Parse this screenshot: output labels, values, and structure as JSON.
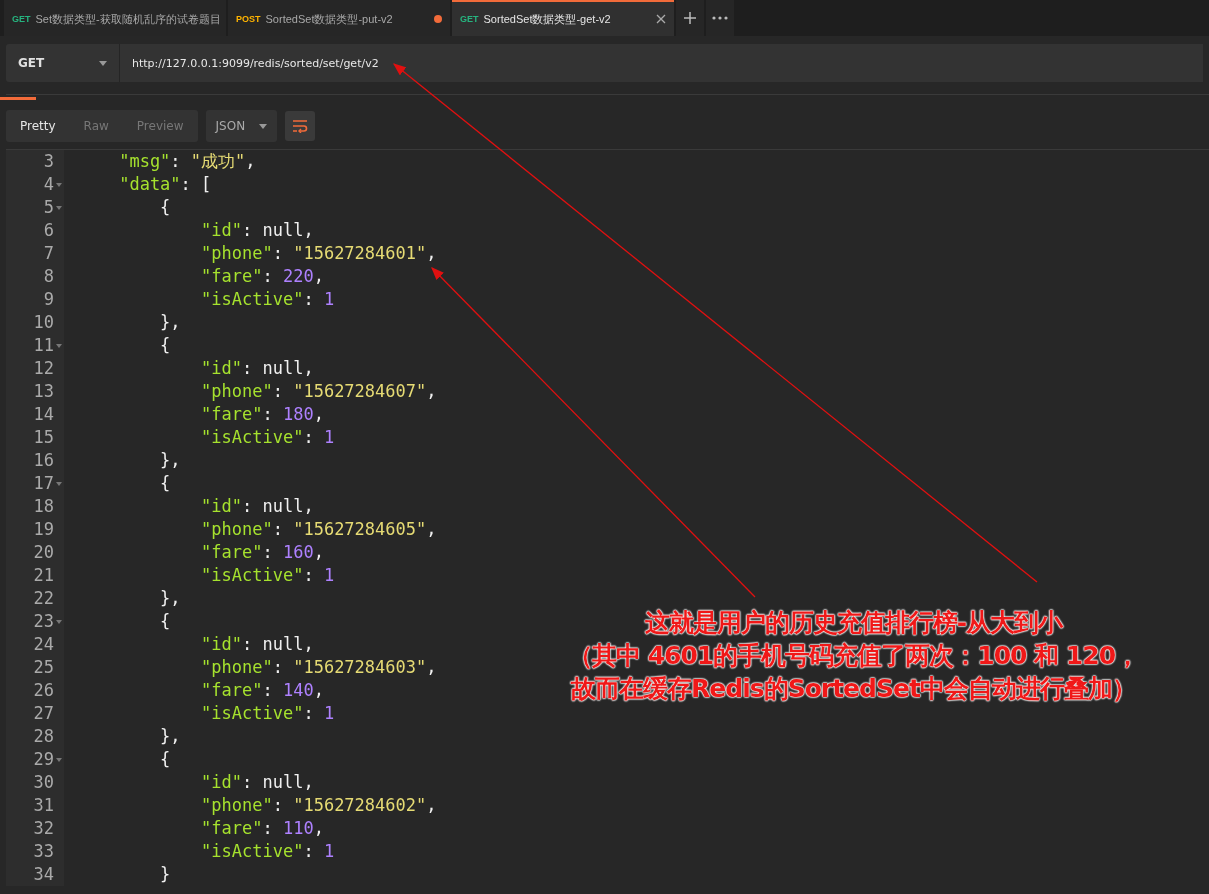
{
  "tabs": [
    {
      "method": "GET",
      "title": "Set数据类型-获取随机乱序的试卷题目",
      "selected": false,
      "unsaved": false
    },
    {
      "method": "POST",
      "title": "SortedSet数据类型-put-v2",
      "selected": false,
      "unsaved": true
    },
    {
      "method": "GET",
      "title": "SortedSet数据类型-get-v2",
      "selected": true,
      "unsaved": false
    }
  ],
  "request": {
    "method": "GET",
    "url": "http://127.0.0.1:9099/redis/sorted/set/get/v2"
  },
  "response_tab_indicator": {
    "level": 0.03
  },
  "view_modes": [
    {
      "label": "Pretty",
      "selected": true
    },
    {
      "label": "Raw",
      "selected": false
    },
    {
      "label": "Preview",
      "selected": false
    }
  ],
  "format": "JSON",
  "code_lines": [
    {
      "number": "3",
      "foldable": false,
      "tokens": [
        {
          "kind": "key",
          "text": "\"msg\""
        },
        {
          "kind": "punct",
          "text": ": "
        },
        {
          "kind": "string",
          "text": "\"成功\""
        },
        {
          "kind": "punct",
          "text": ","
        }
      ]
    },
    {
      "number": "4",
      "foldable": true,
      "tokens": [
        {
          "kind": "key",
          "text": "\"data\""
        },
        {
          "kind": "punct",
          "text": ": ["
        }
      ]
    },
    {
      "number": "5",
      "foldable": true,
      "tokens": [
        {
          "kind": "punct",
          "text": "{"
        }
      ]
    },
    {
      "number": "6",
      "foldable": false,
      "tokens": [
        {
          "kind": "key",
          "text": "\"id\""
        },
        {
          "kind": "punct",
          "text": ": null,"
        }
      ]
    },
    {
      "number": "7",
      "foldable": false,
      "tokens": [
        {
          "kind": "key",
          "text": "\"phone\""
        },
        {
          "kind": "punct",
          "text": ": "
        },
        {
          "kind": "string",
          "text": "\"15627284601\""
        },
        {
          "kind": "punct",
          "text": ","
        }
      ]
    },
    {
      "number": "8",
      "foldable": false,
      "tokens": [
        {
          "kind": "key",
          "text": "\"fare\""
        },
        {
          "kind": "punct",
          "text": ": "
        },
        {
          "kind": "number",
          "text": "220"
        },
        {
          "kind": "punct",
          "text": ","
        }
      ]
    },
    {
      "number": "9",
      "foldable": false,
      "tokens": [
        {
          "kind": "key",
          "text": "\"isActive\""
        },
        {
          "kind": "punct",
          "text": ": "
        },
        {
          "kind": "number",
          "text": "1"
        }
      ]
    },
    {
      "number": "10",
      "foldable": false,
      "tokens": [
        {
          "kind": "punct",
          "text": "},"
        }
      ]
    },
    {
      "number": "11",
      "foldable": true,
      "tokens": [
        {
          "kind": "punct",
          "text": "{"
        }
      ]
    },
    {
      "number": "12",
      "foldable": false,
      "tokens": [
        {
          "kind": "key",
          "text": "\"id\""
        },
        {
          "kind": "punct",
          "text": ": null,"
        }
      ]
    },
    {
      "number": "13",
      "foldable": false,
      "tokens": [
        {
          "kind": "key",
          "text": "\"phone\""
        },
        {
          "kind": "punct",
          "text": ": "
        },
        {
          "kind": "string",
          "text": "\"15627284607\""
        },
        {
          "kind": "punct",
          "text": ","
        }
      ]
    },
    {
      "number": "14",
      "foldable": false,
      "tokens": [
        {
          "kind": "key",
          "text": "\"fare\""
        },
        {
          "kind": "punct",
          "text": ": "
        },
        {
          "kind": "number",
          "text": "180"
        },
        {
          "kind": "punct",
          "text": ","
        }
      ]
    },
    {
      "number": "15",
      "foldable": false,
      "tokens": [
        {
          "kind": "key",
          "text": "\"isActive\""
        },
        {
          "kind": "punct",
          "text": ": "
        },
        {
          "kind": "number",
          "text": "1"
        }
      ]
    },
    {
      "number": "16",
      "foldable": false,
      "tokens": [
        {
          "kind": "punct",
          "text": "},"
        }
      ]
    },
    {
      "number": "17",
      "foldable": true,
      "tokens": [
        {
          "kind": "punct",
          "text": "{"
        }
      ]
    },
    {
      "number": "18",
      "foldable": false,
      "tokens": [
        {
          "kind": "key",
          "text": "\"id\""
        },
        {
          "kind": "punct",
          "text": ": null,"
        }
      ]
    },
    {
      "number": "19",
      "foldable": false,
      "tokens": [
        {
          "kind": "key",
          "text": "\"phone\""
        },
        {
          "kind": "punct",
          "text": ": "
        },
        {
          "kind": "string",
          "text": "\"15627284605\""
        },
        {
          "kind": "punct",
          "text": ","
        }
      ]
    },
    {
      "number": "20",
      "foldable": false,
      "tokens": [
        {
          "kind": "key",
          "text": "\"fare\""
        },
        {
          "kind": "punct",
          "text": ": "
        },
        {
          "kind": "number",
          "text": "160"
        },
        {
          "kind": "punct",
          "text": ","
        }
      ]
    },
    {
      "number": "21",
      "foldable": false,
      "tokens": [
        {
          "kind": "key",
          "text": "\"isActive\""
        },
        {
          "kind": "punct",
          "text": ": "
        },
        {
          "kind": "number",
          "text": "1"
        }
      ]
    },
    {
      "number": "22",
      "foldable": false,
      "tokens": [
        {
          "kind": "punct",
          "text": "},"
        }
      ]
    },
    {
      "number": "23",
      "foldable": true,
      "tokens": [
        {
          "kind": "punct",
          "text": "{"
        }
      ]
    },
    {
      "number": "24",
      "foldable": false,
      "tokens": [
        {
          "kind": "key",
          "text": "\"id\""
        },
        {
          "kind": "punct",
          "text": ": null,"
        }
      ]
    },
    {
      "number": "25",
      "foldable": false,
      "tokens": [
        {
          "kind": "key",
          "text": "\"phone\""
        },
        {
          "kind": "punct",
          "text": ": "
        },
        {
          "kind": "string",
          "text": "\"15627284603\""
        },
        {
          "kind": "punct",
          "text": ","
        }
      ]
    },
    {
      "number": "26",
      "foldable": false,
      "tokens": [
        {
          "kind": "key",
          "text": "\"fare\""
        },
        {
          "kind": "punct",
          "text": ": "
        },
        {
          "kind": "number",
          "text": "140"
        },
        {
          "kind": "punct",
          "text": ","
        }
      ]
    },
    {
      "number": "27",
      "foldable": false,
      "tokens": [
        {
          "kind": "key",
          "text": "\"isActive\""
        },
        {
          "kind": "punct",
          "text": ": "
        },
        {
          "kind": "number",
          "text": "1"
        }
      ]
    },
    {
      "number": "28",
      "foldable": false,
      "tokens": [
        {
          "kind": "punct",
          "text": "},"
        }
      ]
    },
    {
      "number": "29",
      "foldable": true,
      "tokens": [
        {
          "kind": "punct",
          "text": "{"
        }
      ]
    },
    {
      "number": "30",
      "foldable": false,
      "tokens": [
        {
          "kind": "key",
          "text": "\"id\""
        },
        {
          "kind": "punct",
          "text": ": null,"
        }
      ]
    },
    {
      "number": "31",
      "foldable": false,
      "tokens": [
        {
          "kind": "key",
          "text": "\"phone\""
        },
        {
          "kind": "punct",
          "text": ": "
        },
        {
          "kind": "string",
          "text": "\"15627284602\""
        },
        {
          "kind": "punct",
          "text": ","
        }
      ]
    },
    {
      "number": "32",
      "foldable": false,
      "tokens": [
        {
          "kind": "key",
          "text": "\"fare\""
        },
        {
          "kind": "punct",
          "text": ": "
        },
        {
          "kind": "number",
          "text": "110"
        },
        {
          "kind": "punct",
          "text": ","
        }
      ]
    },
    {
      "number": "33",
      "foldable": false,
      "tokens": [
        {
          "kind": "key",
          "text": "\"isActive\""
        },
        {
          "kind": "punct",
          "text": ": "
        },
        {
          "kind": "number",
          "text": "1"
        }
      ]
    },
    {
      "number": "34",
      "foldable": false,
      "tokens": [
        {
          "kind": "punct",
          "text": "}"
        }
      ]
    }
  ],
  "annotation": {
    "lines": [
      "这就是用户的历史充值排行榜-从大到小",
      "（其中  4601的手机号码充值了两次：100 和 120，",
      "故而在缓存Redis的SortedSet中会自动进行叠加）"
    ]
  }
}
